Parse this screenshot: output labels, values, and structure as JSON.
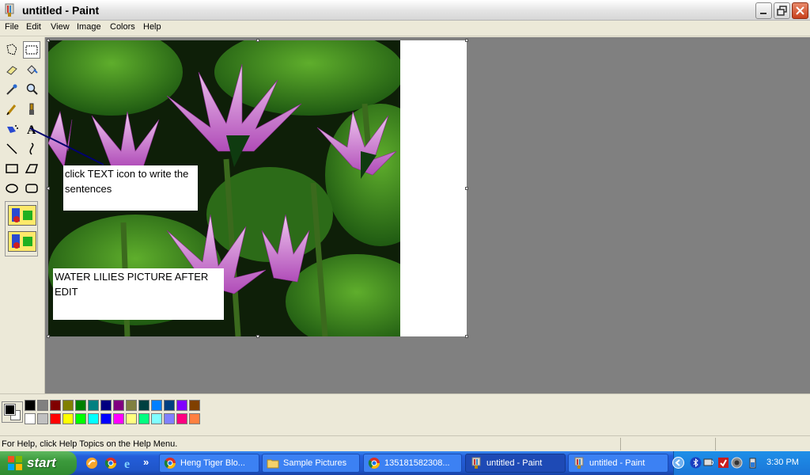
{
  "window": {
    "title": "untitled - Paint"
  },
  "menu": [
    "File",
    "Edit",
    "View",
    "Image",
    "Colors",
    "Help"
  ],
  "tools": [
    {
      "name": "free-form-select-icon"
    },
    {
      "name": "select-icon",
      "selected": true
    },
    {
      "name": "eraser-icon"
    },
    {
      "name": "fill-icon"
    },
    {
      "name": "pick-color-icon"
    },
    {
      "name": "magnifier-icon"
    },
    {
      "name": "pencil-icon"
    },
    {
      "name": "brush-icon"
    },
    {
      "name": "airbrush-icon"
    },
    {
      "name": "text-icon"
    },
    {
      "name": "line-icon"
    },
    {
      "name": "curve-icon"
    },
    {
      "name": "rectangle-icon"
    },
    {
      "name": "polygon-icon"
    },
    {
      "name": "ellipse-icon"
    },
    {
      "name": "rounded-rectangle-icon"
    }
  ],
  "canvas": {
    "annotation_text": "click TEXT icon to write the sentences",
    "caption_text": "WATER LILIES PICTURE AFTER EDIT",
    "line_color": "#00006e"
  },
  "palette": {
    "foreground": "#000000",
    "background": "#ffffff",
    "row1": [
      "#000000",
      "#808080",
      "#800000",
      "#808000",
      "#008000",
      "#008080",
      "#000080",
      "#800080",
      "#808040",
      "#004040",
      "#0080ff",
      "#004080",
      "#8000ff",
      "#804000"
    ],
    "row2": [
      "#ffffff",
      "#c0c0c0",
      "#ff0000",
      "#ffff00",
      "#00ff00",
      "#00ffff",
      "#0000ff",
      "#ff00ff",
      "#ffff80",
      "#00ff80",
      "#80ffff",
      "#8080ff",
      "#ff0080",
      "#ff8040"
    ]
  },
  "status": {
    "help_text": "For Help, click Help Topics on the Help Menu."
  },
  "taskbar": {
    "start_label": "start",
    "more_label": "»",
    "tasks": [
      {
        "label": "Heng Tiger Blo...",
        "icon": "chrome-icon"
      },
      {
        "label": "Sample Pictures",
        "icon": "folder-icon"
      },
      {
        "label": "135181582308...",
        "icon": "chrome-icon"
      },
      {
        "label": "untitled - Paint",
        "icon": "paint-icon",
        "active": true
      },
      {
        "label": "untitled - Paint",
        "icon": "paint-icon"
      }
    ],
    "clock": "3:30 PM"
  }
}
